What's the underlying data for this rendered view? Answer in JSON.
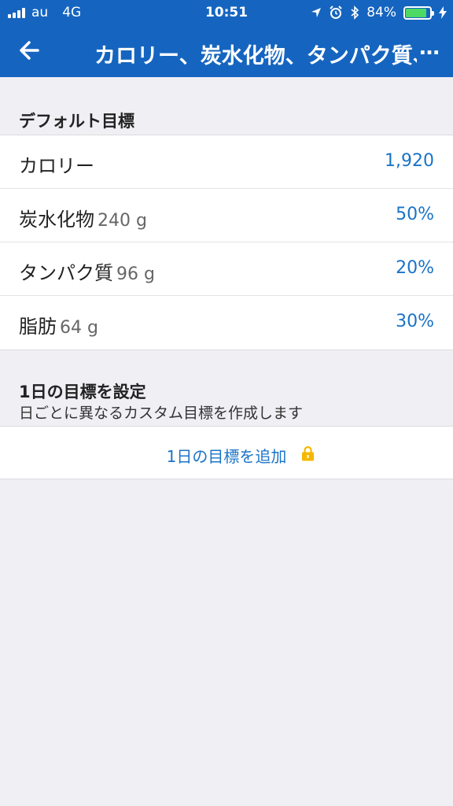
{
  "status_bar": {
    "carrier": "au",
    "network": "4G",
    "time": "10:51",
    "battery": "84%",
    "battery_level": 0.84
  },
  "nav": {
    "title": "カロリー、炭水化物、タンパク質、",
    "more": "…"
  },
  "default_goals": {
    "title": "デフォルト目標",
    "rows": [
      {
        "label": "カロリー",
        "grams": "",
        "value": "1,920"
      },
      {
        "label": "炭水化物",
        "grams": "240 g",
        "value": "50%"
      },
      {
        "label": "タンパク質",
        "grams": "96 g",
        "value": "20%"
      },
      {
        "label": "脂肪",
        "grams": "64 g",
        "value": "30%"
      }
    ]
  },
  "daily_goals": {
    "title": "1日の目標を設定",
    "subtitle": "日ごとに異なるカスタム目標を作成します",
    "add_label": "1日の目標を追加"
  },
  "colors": {
    "header": "#1565c0",
    "accent": "#1a73c7",
    "lock": "#f5b800",
    "background": "#efeff4"
  }
}
